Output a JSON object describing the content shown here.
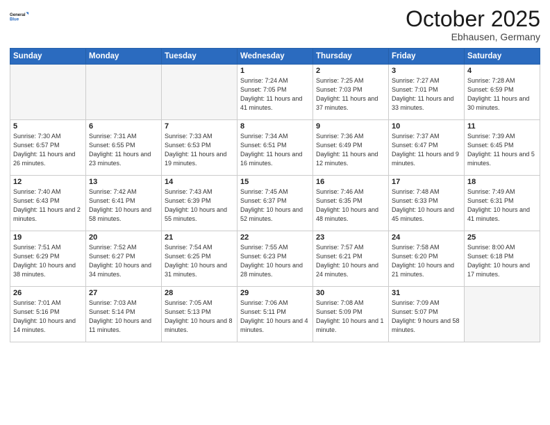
{
  "logo": {
    "line1": "General",
    "line2": "Blue"
  },
  "title": "October 2025",
  "location": "Ebhausen, Germany",
  "days_header": [
    "Sunday",
    "Monday",
    "Tuesday",
    "Wednesday",
    "Thursday",
    "Friday",
    "Saturday"
  ],
  "weeks": [
    [
      {
        "day": "",
        "info": ""
      },
      {
        "day": "",
        "info": ""
      },
      {
        "day": "",
        "info": ""
      },
      {
        "day": "1",
        "info": "Sunrise: 7:24 AM\nSunset: 7:05 PM\nDaylight: 11 hours\nand 41 minutes."
      },
      {
        "day": "2",
        "info": "Sunrise: 7:25 AM\nSunset: 7:03 PM\nDaylight: 11 hours\nand 37 minutes."
      },
      {
        "day": "3",
        "info": "Sunrise: 7:27 AM\nSunset: 7:01 PM\nDaylight: 11 hours\nand 33 minutes."
      },
      {
        "day": "4",
        "info": "Sunrise: 7:28 AM\nSunset: 6:59 PM\nDaylight: 11 hours\nand 30 minutes."
      }
    ],
    [
      {
        "day": "5",
        "info": "Sunrise: 7:30 AM\nSunset: 6:57 PM\nDaylight: 11 hours\nand 26 minutes."
      },
      {
        "day": "6",
        "info": "Sunrise: 7:31 AM\nSunset: 6:55 PM\nDaylight: 11 hours\nand 23 minutes."
      },
      {
        "day": "7",
        "info": "Sunrise: 7:33 AM\nSunset: 6:53 PM\nDaylight: 11 hours\nand 19 minutes."
      },
      {
        "day": "8",
        "info": "Sunrise: 7:34 AM\nSunset: 6:51 PM\nDaylight: 11 hours\nand 16 minutes."
      },
      {
        "day": "9",
        "info": "Sunrise: 7:36 AM\nSunset: 6:49 PM\nDaylight: 11 hours\nand 12 minutes."
      },
      {
        "day": "10",
        "info": "Sunrise: 7:37 AM\nSunset: 6:47 PM\nDaylight: 11 hours\nand 9 minutes."
      },
      {
        "day": "11",
        "info": "Sunrise: 7:39 AM\nSunset: 6:45 PM\nDaylight: 11 hours\nand 5 minutes."
      }
    ],
    [
      {
        "day": "12",
        "info": "Sunrise: 7:40 AM\nSunset: 6:43 PM\nDaylight: 11 hours\nand 2 minutes."
      },
      {
        "day": "13",
        "info": "Sunrise: 7:42 AM\nSunset: 6:41 PM\nDaylight: 10 hours\nand 58 minutes."
      },
      {
        "day": "14",
        "info": "Sunrise: 7:43 AM\nSunset: 6:39 PM\nDaylight: 10 hours\nand 55 minutes."
      },
      {
        "day": "15",
        "info": "Sunrise: 7:45 AM\nSunset: 6:37 PM\nDaylight: 10 hours\nand 52 minutes."
      },
      {
        "day": "16",
        "info": "Sunrise: 7:46 AM\nSunset: 6:35 PM\nDaylight: 10 hours\nand 48 minutes."
      },
      {
        "day": "17",
        "info": "Sunrise: 7:48 AM\nSunset: 6:33 PM\nDaylight: 10 hours\nand 45 minutes."
      },
      {
        "day": "18",
        "info": "Sunrise: 7:49 AM\nSunset: 6:31 PM\nDaylight: 10 hours\nand 41 minutes."
      }
    ],
    [
      {
        "day": "19",
        "info": "Sunrise: 7:51 AM\nSunset: 6:29 PM\nDaylight: 10 hours\nand 38 minutes."
      },
      {
        "day": "20",
        "info": "Sunrise: 7:52 AM\nSunset: 6:27 PM\nDaylight: 10 hours\nand 34 minutes."
      },
      {
        "day": "21",
        "info": "Sunrise: 7:54 AM\nSunset: 6:25 PM\nDaylight: 10 hours\nand 31 minutes."
      },
      {
        "day": "22",
        "info": "Sunrise: 7:55 AM\nSunset: 6:23 PM\nDaylight: 10 hours\nand 28 minutes."
      },
      {
        "day": "23",
        "info": "Sunrise: 7:57 AM\nSunset: 6:21 PM\nDaylight: 10 hours\nand 24 minutes."
      },
      {
        "day": "24",
        "info": "Sunrise: 7:58 AM\nSunset: 6:20 PM\nDaylight: 10 hours\nand 21 minutes."
      },
      {
        "day": "25",
        "info": "Sunrise: 8:00 AM\nSunset: 6:18 PM\nDaylight: 10 hours\nand 17 minutes."
      }
    ],
    [
      {
        "day": "26",
        "info": "Sunrise: 7:01 AM\nSunset: 5:16 PM\nDaylight: 10 hours\nand 14 minutes."
      },
      {
        "day": "27",
        "info": "Sunrise: 7:03 AM\nSunset: 5:14 PM\nDaylight: 10 hours\nand 11 minutes."
      },
      {
        "day": "28",
        "info": "Sunrise: 7:05 AM\nSunset: 5:13 PM\nDaylight: 10 hours\nand 8 minutes."
      },
      {
        "day": "29",
        "info": "Sunrise: 7:06 AM\nSunset: 5:11 PM\nDaylight: 10 hours\nand 4 minutes."
      },
      {
        "day": "30",
        "info": "Sunrise: 7:08 AM\nSunset: 5:09 PM\nDaylight: 10 hours\nand 1 minute."
      },
      {
        "day": "31",
        "info": "Sunrise: 7:09 AM\nSunset: 5:07 PM\nDaylight: 9 hours\nand 58 minutes."
      },
      {
        "day": "",
        "info": ""
      }
    ]
  ]
}
